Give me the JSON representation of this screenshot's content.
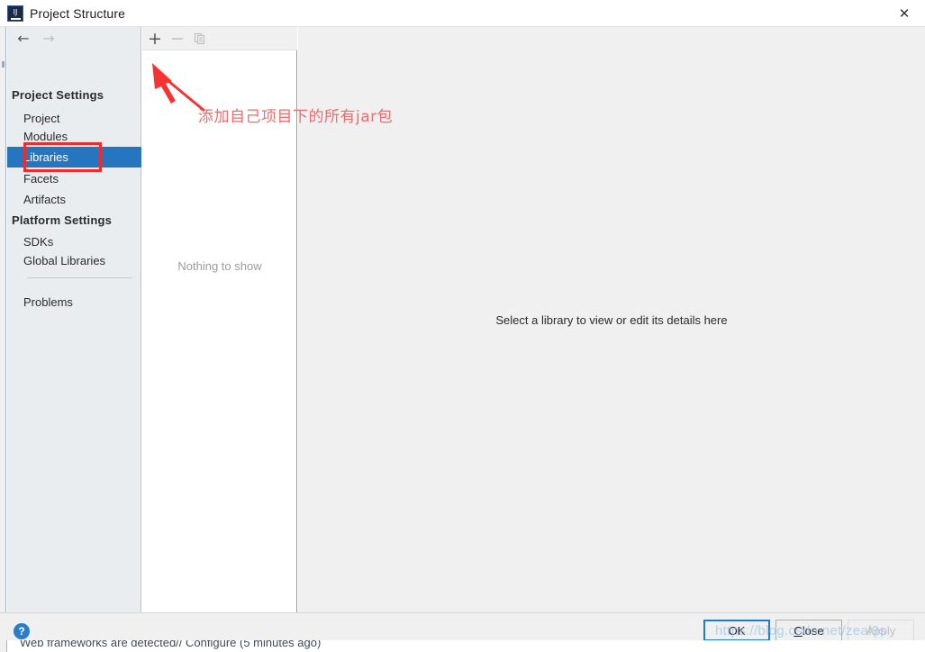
{
  "window": {
    "title": "Project Structure",
    "app_icon": "intellij-idea-icon",
    "icon_letters": "IJ",
    "close_label": "✕"
  },
  "nav": {
    "back": "←",
    "forward": "→"
  },
  "sidebar": {
    "groups": [
      {
        "label": "Project Settings"
      },
      {
        "label": "Platform Settings"
      }
    ],
    "items": [
      {
        "label": "Project",
        "selected": false
      },
      {
        "label": "Modules",
        "selected": false
      },
      {
        "label": "Libraries",
        "selected": true
      },
      {
        "label": "Facets",
        "selected": false
      },
      {
        "label": "Artifacts",
        "selected": false
      },
      {
        "label": "SDKs",
        "selected": false
      },
      {
        "label": "Global Libraries",
        "selected": false
      },
      {
        "label": "Problems",
        "selected": false
      }
    ]
  },
  "library_list": {
    "toolbar": {
      "add_label": "+",
      "remove_label": "−",
      "copy_name": "copy-icon"
    },
    "empty_text": "Nothing to show"
  },
  "detail_panel": {
    "empty_text": "Select a library to view or edit its details here"
  },
  "annotation": {
    "text": "添加自己项目下的所有jar包",
    "color": "#f4696c",
    "arrow_name": "red-pointer-arrow",
    "highlight_color": "#f12b2b",
    "highlight_target": "Libraries"
  },
  "footer": {
    "help_label": "?",
    "ok_label": "OK",
    "close_label": "Close",
    "close_mnemonic": "C",
    "close_rest": "lose",
    "apply_label": "Apply",
    "apply_enabled": false
  },
  "watermark": {
    "text": "https://blog.csdn.net/zeal9s"
  },
  "background_status": {
    "text": "Web frameworks are detected// Configure (5 minutes ago)"
  },
  "colors": {
    "selection_blue": "#2675bf",
    "annotation_red": "#f12b2b",
    "sidebar_bg": "#e9edf0",
    "panel_bg": "#f0f0f0",
    "accent_button_border": "#1a7dd6"
  }
}
